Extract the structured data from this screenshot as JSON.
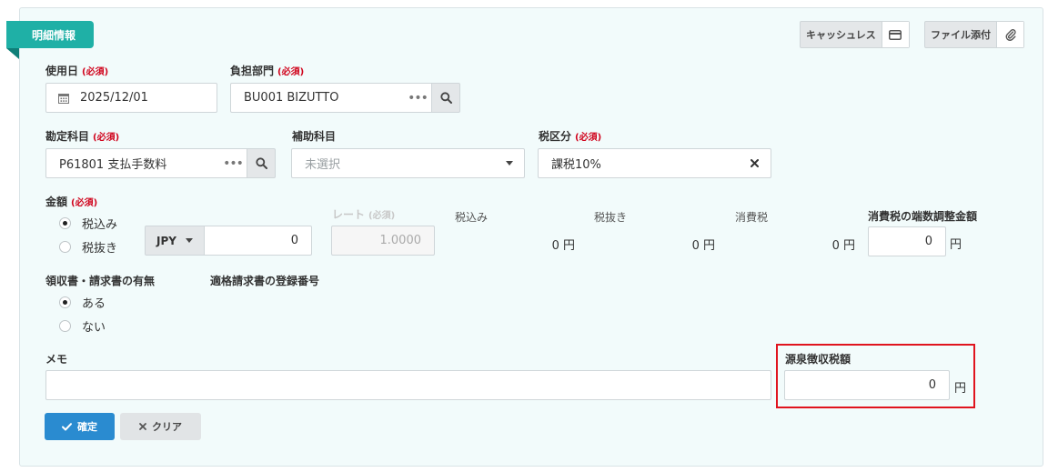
{
  "section": {
    "title": "明細情報"
  },
  "toolbar": {
    "cashless_label": "キャッシュレス",
    "attach_label": "ファイル添付"
  },
  "required_tag": "(必須)",
  "fields": {
    "usage_date": {
      "label": "使用日",
      "value": "2025/12/01"
    },
    "department": {
      "label": "負担部門",
      "value": "BU001 BIZUTTO"
    },
    "account": {
      "label": "勘定科目",
      "value": "P61801 支払手数料"
    },
    "sub_account": {
      "label": "補助科目",
      "placeholder": "未選択"
    },
    "tax_category": {
      "label": "税区分",
      "value": "課税10%"
    },
    "amount": {
      "label": "金額",
      "options": [
        "税込み",
        "税抜き"
      ],
      "selected": "税込み",
      "currency": "JPY",
      "value": "0"
    },
    "rate": {
      "label": "レート",
      "value": "1.0000"
    },
    "totals": {
      "incl_label": "税込み",
      "incl_value": "0 円",
      "excl_label": "税抜き",
      "excl_value": "0 円",
      "tax_label": "消費税",
      "tax_value": "0 円"
    },
    "rounding_adjust": {
      "label": "消費税の端数調整金額",
      "value": "0",
      "unit": "円"
    },
    "receipt": {
      "label": "領収書・請求書の有無",
      "options": [
        "ある",
        "ない"
      ],
      "selected": "ある"
    },
    "invoice_number": {
      "label": "適格請求書の登録番号"
    },
    "memo": {
      "label": "メモ",
      "value": ""
    },
    "withholding_tax": {
      "label": "源泉徴収税額",
      "value": "0",
      "unit": "円"
    }
  },
  "actions": {
    "confirm_label": "確定",
    "clear_label": "クリア"
  },
  "colors": {
    "accent": "#1fb0a6",
    "primary": "#2a8bd0",
    "required": "#d0021b",
    "highlight": "#e0141e"
  }
}
